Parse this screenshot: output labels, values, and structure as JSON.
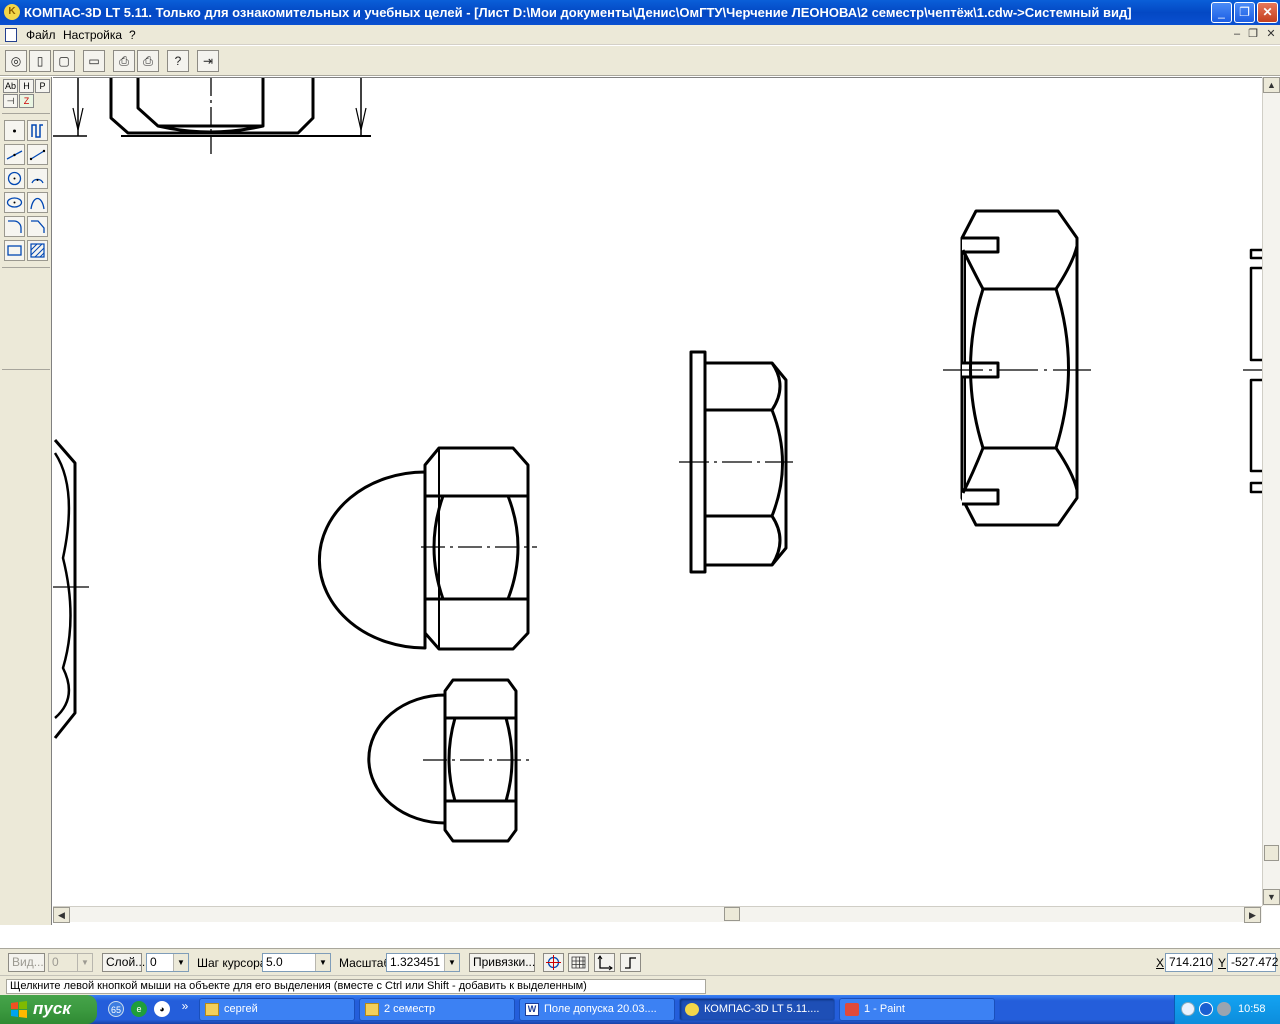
{
  "window": {
    "title": "КОМПАС-3D LT 5.11. Только для ознакомительных и учебных целей - [Лист D:\\Мои документы\\Денис\\ОмГТУ\\Черчение ЛЕОНОВА\\2 семестр\\чептёж\\1.cdw->Системный вид]",
    "app_icon": "kompas-icon"
  },
  "menu": {
    "items": [
      {
        "label": "Файл"
      },
      {
        "label": "Настройка"
      },
      {
        "label": "?"
      }
    ]
  },
  "left_panel": {
    "tabs_row1": [
      "Ab",
      "H",
      "P"
    ],
    "tabs_row2": [
      "⊣",
      "Z"
    ]
  },
  "property_bar": {
    "view_button": "Вид...",
    "view_value": "0",
    "layer_button": "Слой...",
    "layer_value": "0",
    "step_label": "Шаг курсора",
    "step_value": "5.0",
    "scale_label": "Масштаб",
    "scale_value": "1.323451",
    "snap_button": "Привязки...",
    "x_label": "X",
    "x_value": "714.210",
    "y_label": "Y",
    "y_value": "-527.472"
  },
  "status": {
    "message": "Щелкните левой кнопкой мыши на объекте для его выделения (вместе с Ctrl или Shift - добавить к выделенным)"
  },
  "taskbar": {
    "start_label": "пуск",
    "tasks": [
      {
        "label": "сергей",
        "icon": "folder-icon"
      },
      {
        "label": "2 семестр",
        "icon": "folder-icon"
      },
      {
        "label": "Поле допуска 20.03....",
        "icon": "word-icon"
      },
      {
        "label": "КОМПАС-3D LT 5.11....",
        "icon": "kompas-icon",
        "active": true
      },
      {
        "label": "1 - Paint",
        "icon": "paint-icon"
      }
    ],
    "clock": "10:58"
  }
}
